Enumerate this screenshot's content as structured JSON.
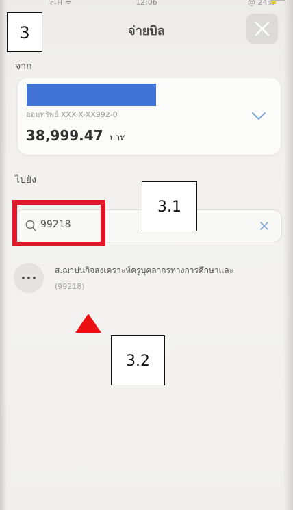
{
  "status_bar": {
    "carrier": "ic-H ᯤ",
    "time": "12:06",
    "battery": "@ 24%"
  },
  "header": {
    "title": "จ่ายบิล"
  },
  "annotations": {
    "step_main": "3",
    "step_search": "3.1",
    "step_result": "3.2",
    "highlight_color": "#e0182a",
    "arrow_color": "#ec1111"
  },
  "from_section": {
    "label": "จาก",
    "account_number": "ออมทรัพย์ XXX-X-XX992-0",
    "balance": "38,999.47",
    "currency": "บาท",
    "name_mask_color": "#4273d6"
  },
  "to_section": {
    "label": "ไปยัง",
    "search": {
      "value": "99218",
      "placeholder": ""
    }
  },
  "results": [
    {
      "name": "ส.ฌาปนกิจสงเคราะห์ครูบุคลากรทางการศึกษาและ",
      "code": "(99218)",
      "icon": "more-icon"
    }
  ]
}
